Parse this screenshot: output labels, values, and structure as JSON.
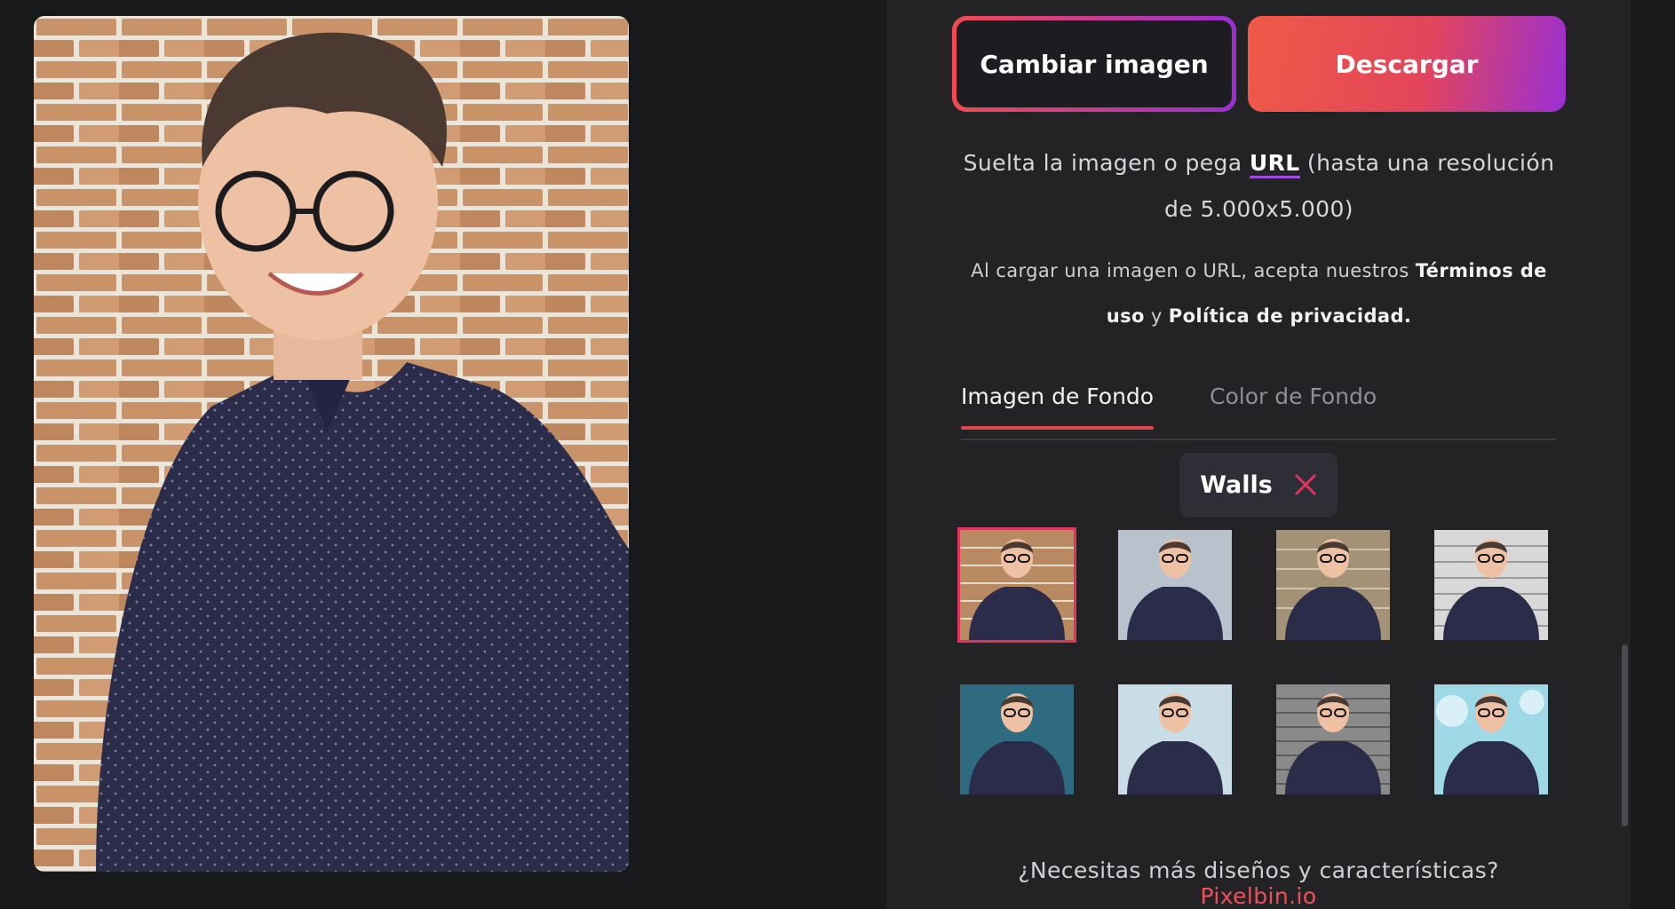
{
  "buttons": {
    "change_image": "Cambiar imagen",
    "download": "Descargar"
  },
  "drop": {
    "before": "Suelta la imagen o pega ",
    "url": "URL",
    "after": " (hasta una resolución de 5.000x5.000)"
  },
  "terms": {
    "before": "Al cargar una imagen o URL, acepta nuestros ",
    "terms_link": "Términos de uso",
    "conj": " y ",
    "privacy_link": "Política de privacidad",
    "end": "."
  },
  "tabs": [
    {
      "label": "Imagen de Fondo",
      "active": true
    },
    {
      "label": "Color de Fondo",
      "active": false
    }
  ],
  "filter_chip": {
    "label": "Walls",
    "close_icon": "close-icon"
  },
  "thumbnails": [
    {
      "background": "brick-wall",
      "selected": true
    },
    {
      "background": "grey-plaster-wall",
      "selected": false
    },
    {
      "background": "stone-brick-wall",
      "selected": false
    },
    {
      "background": "white-brick-wall",
      "selected": false
    },
    {
      "background": "teal-wall",
      "selected": false
    },
    {
      "background": "light-blue-wall",
      "selected": false
    },
    {
      "background": "grey-brick-wall",
      "selected": false
    },
    {
      "background": "cyan-painted-wall",
      "selected": false
    }
  ],
  "footer": {
    "text": "¿Necesitas más diseños y características? ",
    "link": "Pixelbin.io"
  },
  "colors": {
    "accent_red": "#f0505a",
    "accent_purple": "#9b2fd0",
    "panel_bg": "#232325",
    "page_bg": "#18191b"
  }
}
